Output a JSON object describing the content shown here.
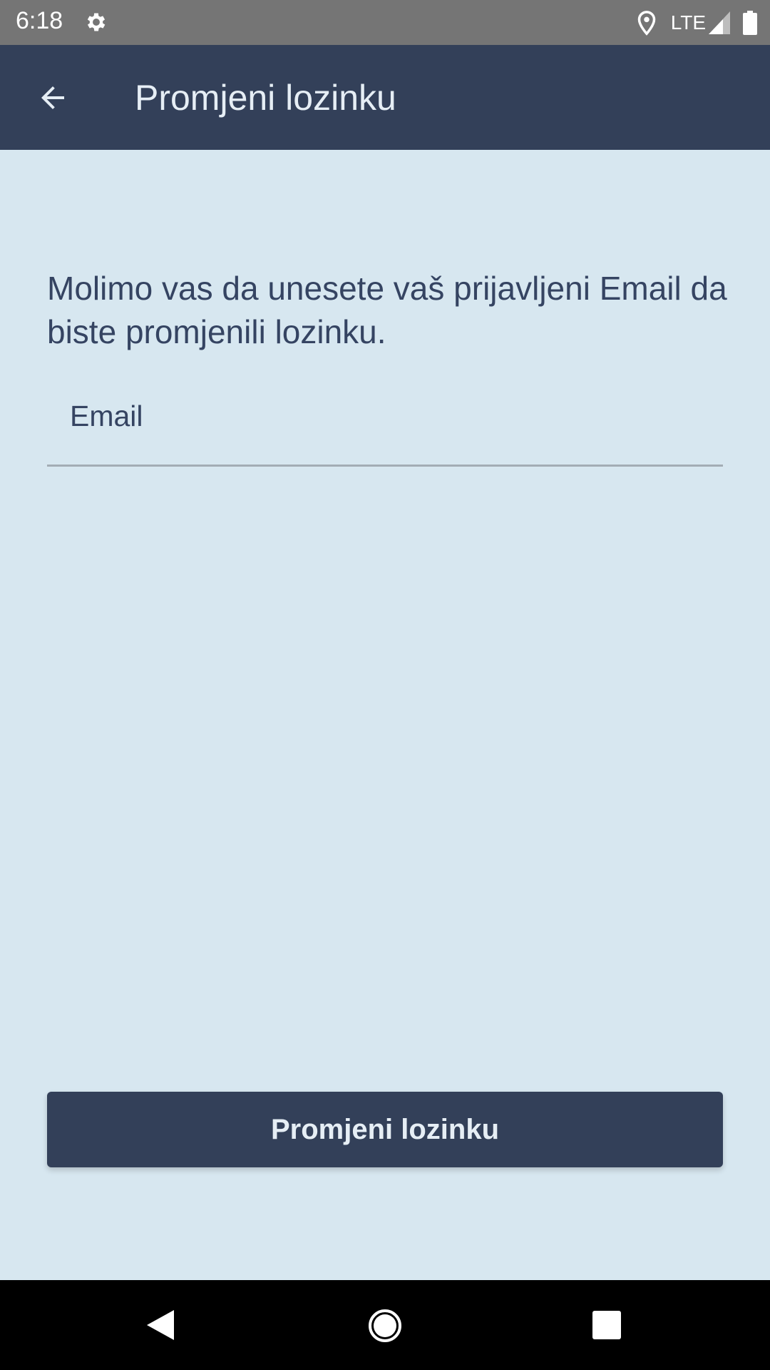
{
  "status_bar": {
    "time": "6:18",
    "network": "LTE",
    "icons": [
      "gear-icon",
      "location-icon",
      "signal-icon",
      "battery-icon"
    ]
  },
  "app_bar": {
    "title": "Promjeni lozinku",
    "back_icon": "arrow-back-icon"
  },
  "form": {
    "instruction": "Molimo vas da unesete vaš prijavljeni Email da biste promjenili lozinku.",
    "email_placeholder": "Email",
    "submit_label": "Promjeni lozinku"
  },
  "colors": {
    "background": "#d7e7f0",
    "app_bar": "#334059",
    "text": "#354462",
    "button": "#334059"
  },
  "nav_bar": {
    "icons": [
      "nav-back-icon",
      "nav-home-icon",
      "nav-recents-icon"
    ]
  }
}
